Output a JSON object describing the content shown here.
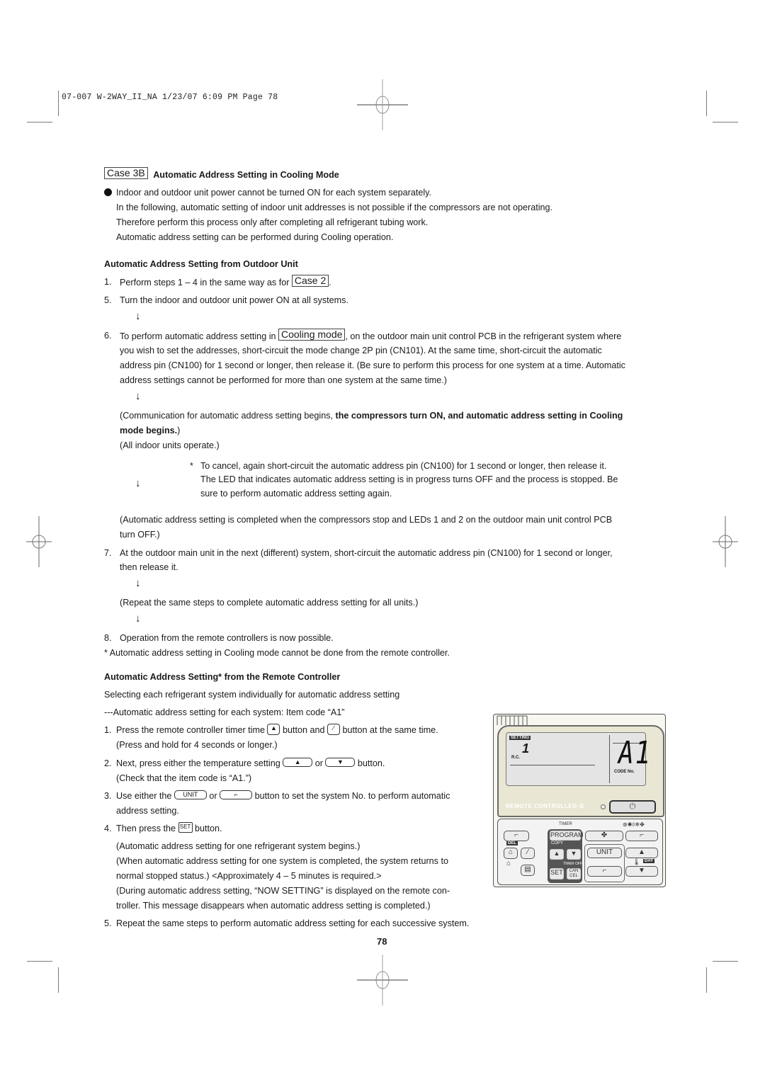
{
  "slug": "07-007 W-2WAY_II_NA  1/23/07  6:09 PM  Page 78",
  "case_box": "Case 3B",
  "heading": "Automatic Address Setting in Cooling Mode",
  "intro": [
    "Indoor and outdoor unit power cannot be turned ON for each system separately.",
    "In the following, automatic setting of indoor unit addresses is not possible if the compressors are not operating.",
    "Therefore perform this process only after completing all refrigerant tubing work.",
    "Automatic address setting can be performed during Cooling operation."
  ],
  "outdoor": {
    "heading": "Automatic Address Setting from Outdoor Unit",
    "step1_num": "1.",
    "step1_text": "Perform steps 1 – 4 in the same way as for",
    "step1_box": "Case 2",
    "step1_end": ".",
    "step5_num": "5.",
    "step5_text": "Turn the indoor and outdoor unit power ON at all systems.",
    "step6_num": "6.",
    "step6_pre": "To perform automatic address setting in",
    "step6_box": "Cooling mode",
    "step6_post": ", on the outdoor main unit control PCB in the refrigerant system where",
    "step6_lines": [
      "you wish to set the addresses, short-circuit the mode change 2P pin (CN101). At the same time, short-circuit the automatic",
      "address pin (CN100) for 1 second or longer, then release it. (Be sure to perform this process for one system at a time. Automatic",
      "address settings cannot be performed for more than one system at the same time.)"
    ],
    "comm_pre": "(Communication for automatic address setting begins, ",
    "comm_bold": "the compressors turn ON, and automatic address setting in Cooling",
    "comm_bold2": "mode begins.",
    "comm_end": ")",
    "all_operate": "(All indoor units operate.)",
    "cancel_star": "*",
    "cancel_lines": [
      "To cancel, again short-circuit the automatic address pin (CN100) for 1 second or longer, then release it.",
      "The LED that indicates automatic address setting is in progress turns OFF and the process is stopped. Be",
      "sure to perform automatic address setting again."
    ],
    "completed_lines": [
      "(Automatic address setting is completed when the compressors stop and LEDs 1 and 2 on the outdoor main unit control PCB",
      "turn OFF.)"
    ],
    "step7_num": "7.",
    "step7_lines": [
      "At the outdoor main unit in the next (different) system, short-circuit the automatic address pin (CN100) for 1 second or longer,",
      "then release it."
    ],
    "repeat": "(Repeat the same steps to complete automatic address setting for all units.)",
    "step8_num": "8.",
    "step8_text": "Operation from the remote controllers is now possible.",
    "note": "* Automatic address setting in Cooling mode cannot be done from the remote controller.",
    "arrow": "↓"
  },
  "remote": {
    "heading": "Automatic Address Setting* from the Remote Controller",
    "intro1": "Selecting each refrigerant system individually for automatic address setting",
    "intro2": "---Automatic address setting for each system: Item code “A1”",
    "s1_num": "1.",
    "s1_a": "Press the remote controller timer time",
    "s1_b": "button and",
    "s1_c": "button at the same time.",
    "s1_sub": "(Press and hold for 4 seconds or longer.)",
    "s2_num": "2.",
    "s2_a": "Next, press either the temperature setting",
    "s2_b": "or",
    "s2_c": "button.",
    "s2_sub": "(Check that the item code is “A1.”)",
    "s3_num": "3.",
    "s3_a": "Use either the",
    "s3_unit": "UNIT",
    "s3_b": "or",
    "s3_c": "button to set the system No. to perform automatic",
    "s3_sub": "address setting.",
    "s4_num": "4.",
    "s4_a": "Then press the",
    "s4_set": "SET",
    "s4_b": "button.",
    "s4_lines": [
      "(Automatic address setting for one refrigerant system begins.)",
      "(When automatic address setting for one system is completed, the system returns to",
      "normal stopped status.) <Approximately 4 – 5 minutes is required.>",
      "(During automatic address setting, “NOW SETTING” is displayed on the remote con-",
      "troller. This message disappears when automatic address setting is completed.)"
    ],
    "s5_num": "5.",
    "s5_text": "Repeat the same steps to perform automatic address setting for each successive system."
  },
  "controller": {
    "setting_tag": "SETTING",
    "rc_digit": "1",
    "rc_label": "R.C.",
    "code_value": "A1",
    "code_label": "CODE No.",
    "brand_label": "REMOTE CONTROLLER-①",
    "power_symbol": "⏻",
    "timer_label": "TIMER",
    "mode_icons": "⊛✺◊❄✤",
    "program": "PROGRAM",
    "copy": "COPY",
    "del": "DEL",
    "set": "SET",
    "cancel": "CAN CEL",
    "timer_off": "TIMER OFF",
    "unit": "UNIT",
    "day": "DAY",
    "up": "▲",
    "down": "▼",
    "fan": "✤"
  },
  "page_number": "78"
}
